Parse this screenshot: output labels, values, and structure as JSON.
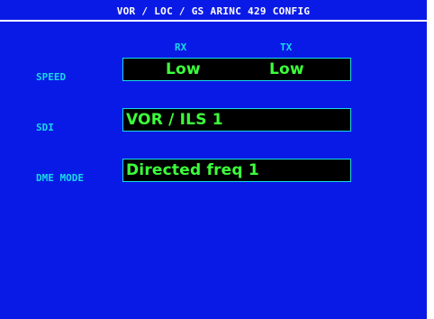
{
  "page": {
    "title": "VOR / LOC / GS ARINC 429 CONFIG"
  },
  "columns": {
    "rx": "RX",
    "tx": "TX"
  },
  "rows": {
    "speed": {
      "label": "SPEED",
      "rx_value": "Low",
      "tx_value": "Low"
    },
    "sdi": {
      "label": "SDI",
      "value": "VOR / ILS 1"
    },
    "dme_mode": {
      "label": "DME MODE",
      "value": "Directed freq 1"
    }
  },
  "colors": {
    "background": "#0a1ae6",
    "label_cyan": "#17d9e8",
    "value_green": "#3cff3c",
    "field_black": "#000000",
    "title_white": "#ffffff"
  }
}
